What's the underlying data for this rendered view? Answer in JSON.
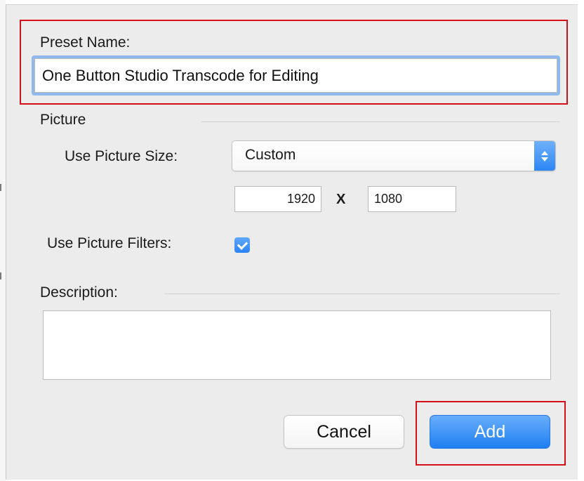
{
  "preset": {
    "label": "Preset Name:",
    "value": "One Button Studio Transcode for Editing"
  },
  "picture": {
    "section_title": "Picture",
    "size_label": "Use Picture Size:",
    "size_value": "Custom",
    "width": "1920",
    "separator": "X",
    "height": "1080",
    "filters_label": "Use Picture Filters:",
    "filters_checked": true
  },
  "description": {
    "label": "Description:",
    "value": ""
  },
  "buttons": {
    "cancel": "Cancel",
    "add": "Add"
  },
  "colors": {
    "highlight": "#d5101a",
    "accent_blue": "#2c86f5",
    "dialog_bg": "#ececec"
  },
  "icons": {
    "popup_arrows": "up-down-chevron-icon",
    "checkbox": "checkmark-icon"
  }
}
